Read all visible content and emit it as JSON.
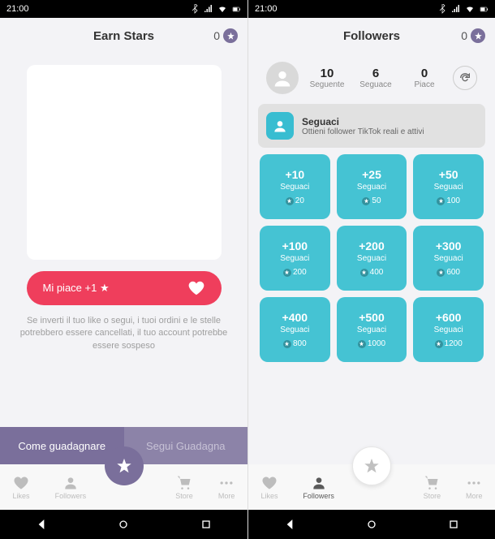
{
  "status": {
    "time": "21:00"
  },
  "left": {
    "header": {
      "title": "Earn Stars",
      "stars": "0"
    },
    "like_button": "Mi piace +1 ★",
    "warning": "Se inverti il tuo like o segui, i tuoi ordini e le stelle potrebbero essere cancellati, il tuo account potrebbe essere sospeso",
    "tabs": {
      "active": "Come guadagnare",
      "inactive": "Segui Guadagna"
    },
    "nav": {
      "likes": "Likes",
      "followers": "Followers",
      "store": "Store",
      "more": "More"
    }
  },
  "right": {
    "header": {
      "title": "Followers",
      "stars": "0"
    },
    "profile": {
      "stats": [
        {
          "num": "10",
          "label": "Seguente"
        },
        {
          "num": "6",
          "label": "Seguace"
        },
        {
          "num": "0",
          "label": "Piace"
        }
      ]
    },
    "banner": {
      "title": "Seguaci",
      "sub": "Ottieni follower TikTok reali e attivi"
    },
    "grid": [
      {
        "amt": "+10",
        "lbl": "Seguaci",
        "cost": "20"
      },
      {
        "amt": "+25",
        "lbl": "Seguaci",
        "cost": "50"
      },
      {
        "amt": "+50",
        "lbl": "Seguaci",
        "cost": "100"
      },
      {
        "amt": "+100",
        "lbl": "Seguaci",
        "cost": "200"
      },
      {
        "amt": "+200",
        "lbl": "Seguaci",
        "cost": "400"
      },
      {
        "amt": "+300",
        "lbl": "Seguaci",
        "cost": "600"
      },
      {
        "amt": "+400",
        "lbl": "Seguaci",
        "cost": "800"
      },
      {
        "amt": "+500",
        "lbl": "Seguaci",
        "cost": "1000"
      },
      {
        "amt": "+600",
        "lbl": "Seguaci",
        "cost": "1200"
      }
    ],
    "nav": {
      "likes": "Likes",
      "followers": "Followers",
      "store": "Store",
      "more": "More"
    }
  }
}
